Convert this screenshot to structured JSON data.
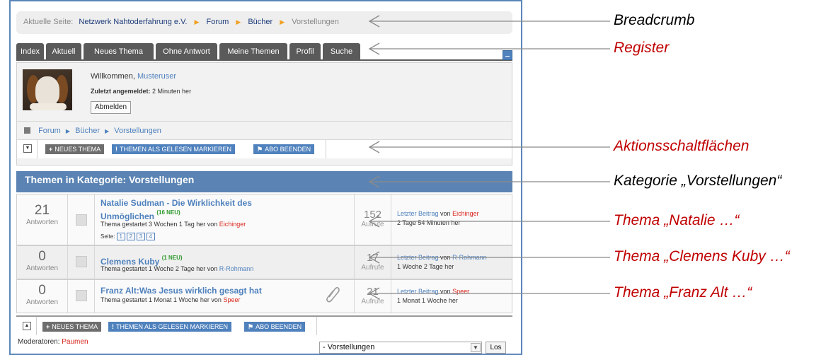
{
  "breadcrumb": {
    "prefix": "Aktuelle Seite:",
    "items": [
      "Netzwerk Nahtoderfahrung e.V.",
      "Forum",
      "Bücher",
      "Vorstellungen"
    ]
  },
  "tabs": [
    "Index",
    "Aktuell",
    "Neues Thema",
    "Ohne Antwort",
    "Meine Themen",
    "Profil",
    "Suche"
  ],
  "user_panel": {
    "welcome": "Willkommen,",
    "username": "Musteruser",
    "last_login_label": "Zuletzt angemeldet:",
    "last_login_value": "2 Minuten her",
    "logout": "Abmelden"
  },
  "sub_breadcrumb": [
    "Forum",
    "Bücher",
    "Vorstellungen"
  ],
  "actions": {
    "new_topic": "NEUES THEMA",
    "mark_read": "THEMEN ALS GELESEN MARKIEREN",
    "unsubscribe": "ABO BEENDEN"
  },
  "category_title": "Themen in Kategorie: Vorstellungen",
  "topics": [
    {
      "replies": "21",
      "replies_label": "Antworten",
      "title_line1": "Natalie Sudman - Die Wirklichkeit des",
      "title_line2": "Unmöglichen",
      "new_badge": "(16 NEU)",
      "meta_prefix": "Thema gestartet 3 Wochen 1 Tag her von",
      "author": "Eichinger",
      "pages_label": "Seite:",
      "pages": [
        "1",
        "2",
        "3",
        "4"
      ],
      "views": "152",
      "views_label": "Aufrufe",
      "last_label": "Letzter Beitrag",
      "last_by_word": "von",
      "last_author": "Eichinger",
      "last_time": "2 Tage 54 Minuten her"
    },
    {
      "replies": "0",
      "replies_label": "Antworten",
      "title_line1": "Clemens Kuby",
      "new_badge": "(1 NEU)",
      "meta_prefix": "Thema gestartet 1 Woche 2 Tage her von",
      "author": "R-Rohmann",
      "views": "17",
      "views_label": "Aufrufe",
      "last_label": "Letzter Beitrag",
      "last_by_word": "von",
      "last_author": "R-Rohmann",
      "last_time": "1 Woche 2 Tage her"
    },
    {
      "replies": "0",
      "replies_label": "Antworten",
      "title_line1": "Franz Alt:Was Jesus wirklich gesagt hat",
      "meta_prefix": "Thema gestartet 1 Monat 1 Woche her von",
      "author": "Speer",
      "views": "21",
      "views_label": "Aufrufe",
      "last_label": "Letzter Beitrag",
      "last_by_word": "von",
      "last_author": "Speer",
      "last_time": "1 Monat 1 Woche her"
    }
  ],
  "moderators_label": "Moderatoren:",
  "moderator": "Paumen",
  "jump_select_value": "- Vorstellungen",
  "go_button": "Los",
  "annotations": {
    "breadcrumb": "Breadcrumb",
    "register": "Register",
    "actions": "Aktionsschaltflächen",
    "category": "Kategorie „Vorstellungen“",
    "topic1": "Thema „Natalie …“",
    "topic2": "Thema „Clemens Kuby …“",
    "topic3": "Thema „Franz Alt …“"
  },
  "colors": {
    "accent_blue": "#4f81bd",
    "header_blue": "#5b84b4",
    "tab_gray": "#5a5a5a",
    "author_red": "#d9261c",
    "annotation_red": "#c00000",
    "new_green": "#2e9a2e"
  },
  "icons": {
    "breadcrumb_separator": "triangle-right-icon",
    "collapse": "collapse-toggle-icon",
    "attachment": "paperclip-icon",
    "topic": "topic-document-icon"
  }
}
